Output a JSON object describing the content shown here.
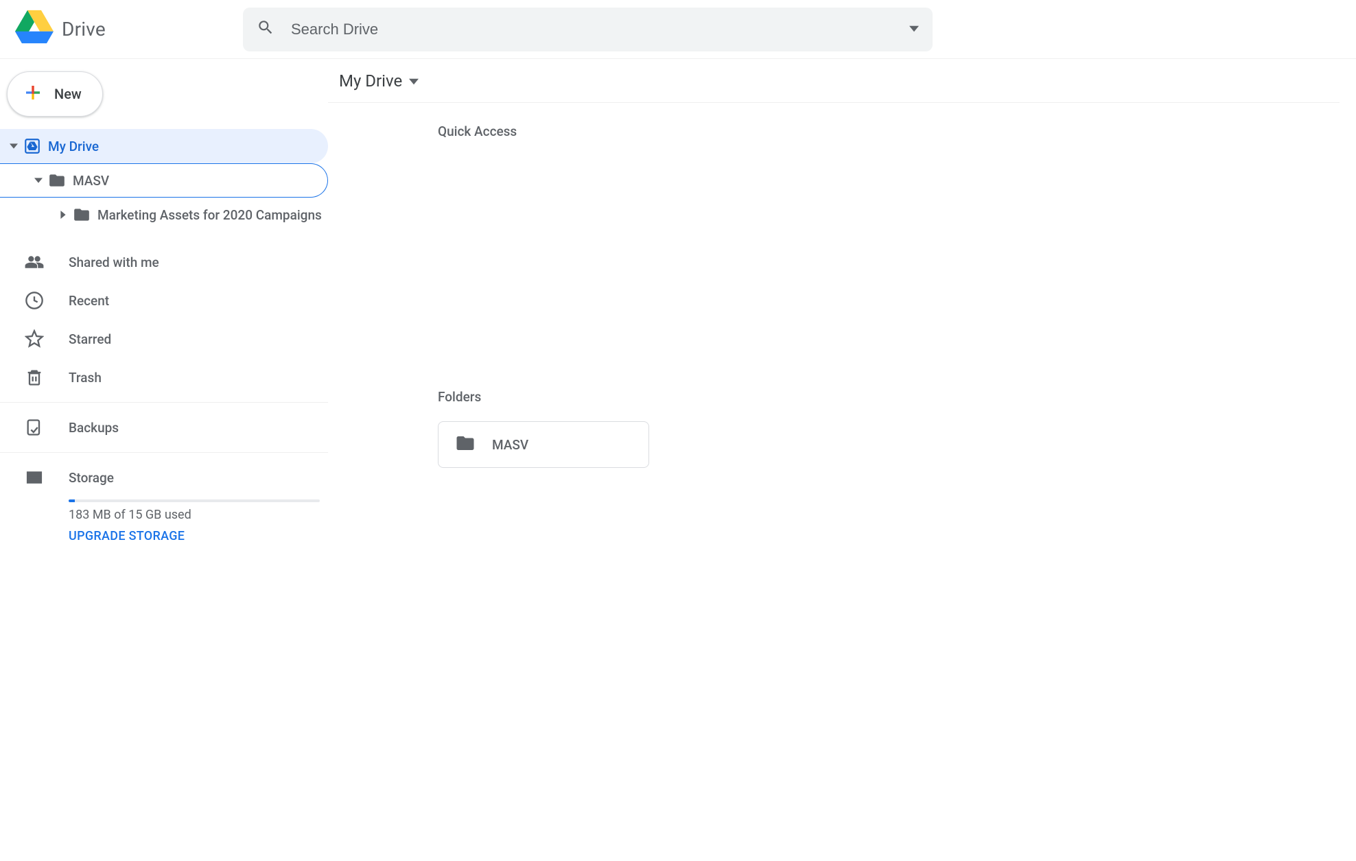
{
  "app": {
    "name": "Drive"
  },
  "search": {
    "placeholder": "Search Drive"
  },
  "sidebar": {
    "new_label": "New",
    "tree": {
      "root": {
        "label": "My Drive"
      },
      "child1": {
        "label": "MASV"
      },
      "child2": {
        "label": "Marketing Assets for 2020 Campaigns"
      }
    },
    "nav": {
      "shared": "Shared with me",
      "recent": "Recent",
      "starred": "Starred",
      "trash": "Trash",
      "backups": "Backups",
      "storage": "Storage"
    },
    "storage": {
      "text": "183 MB of 15 GB used",
      "upgrade": "UPGRADE STORAGE"
    }
  },
  "main": {
    "breadcrumb": "My Drive",
    "sections": {
      "quick_access": "Quick Access",
      "folders": "Folders"
    },
    "folders": [
      {
        "name": "MASV"
      }
    ]
  }
}
